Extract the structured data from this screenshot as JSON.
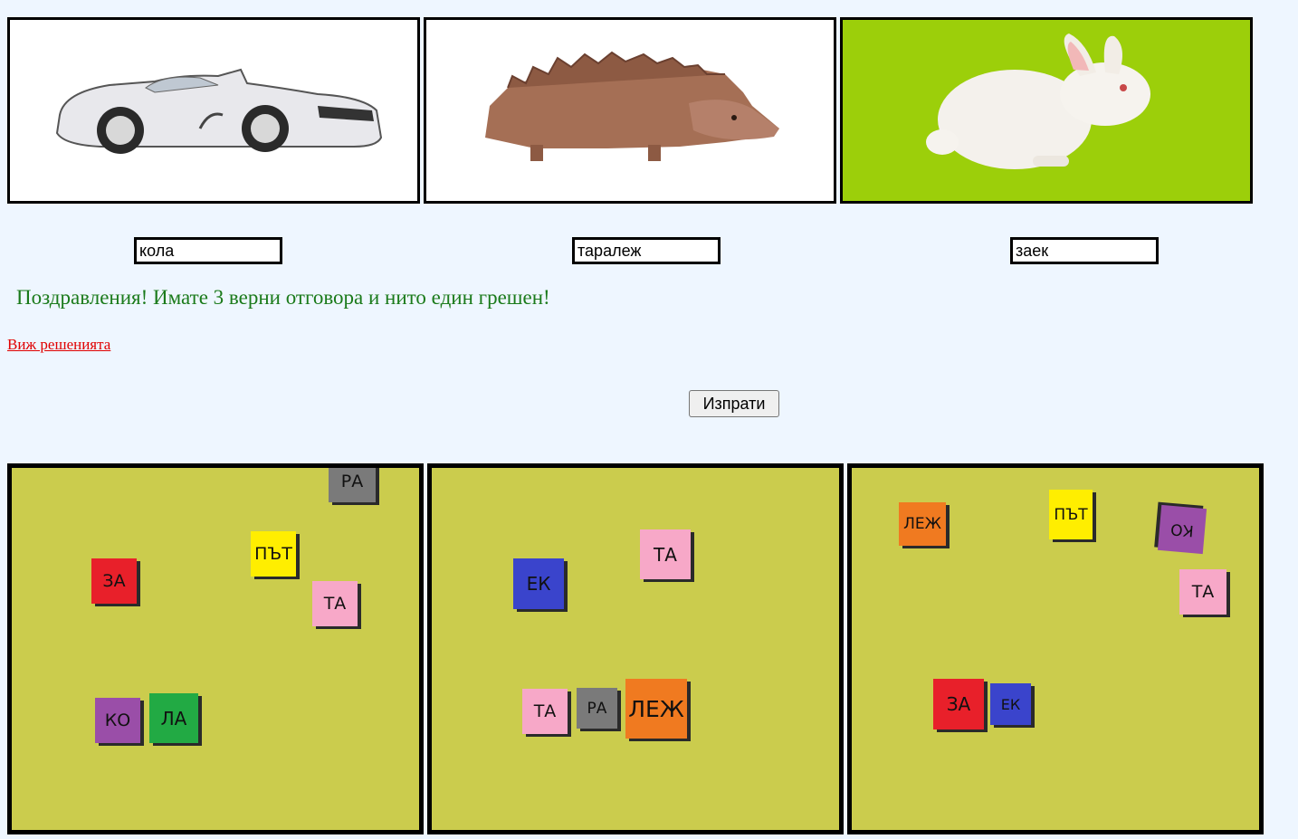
{
  "pictures": [
    {
      "name": "car",
      "background": "#ffffff"
    },
    {
      "name": "hedgehog",
      "background": "#ffffff"
    },
    {
      "name": "rabbit",
      "background": "#9ccf0a"
    }
  ],
  "answers": [
    {
      "value": "кола"
    },
    {
      "value": "таралеж"
    },
    {
      "value": "заек"
    }
  ],
  "result_message": "Поздравления! Имате 3 верни отговора и нито един грешен!",
  "solutions_link": "Виж решенията",
  "submit_label": "Изпрати",
  "boards": [
    {
      "background": "#cbcc4d",
      "cubes": [
        {
          "label": "РА",
          "color": "#7a7a7a"
        },
        {
          "label": "ПЪТ",
          "color": "#ffee00"
        },
        {
          "label": "ЗА",
          "color": "#e8202a"
        },
        {
          "label": "ТА",
          "color": "#f7a8c8"
        },
        {
          "label": "КО",
          "color": "#9a4ea8"
        },
        {
          "label": "ЛА",
          "color": "#22aa44"
        }
      ]
    },
    {
      "background": "#cbcc4d",
      "cubes": [
        {
          "label": "ТА",
          "color": "#f7a8c8"
        },
        {
          "label": "ЕК",
          "color": "#3a44cc"
        },
        {
          "label": "ТА",
          "color": "#f7a8c8"
        },
        {
          "label": "РА",
          "color": "#7a7a7a"
        },
        {
          "label": "ЛЕЖ",
          "color": "#f07a20"
        }
      ]
    },
    {
      "background": "#cbcc4d",
      "cubes": [
        {
          "label": "ЛЕЖ",
          "color": "#f07a20"
        },
        {
          "label": "ПЪТ",
          "color": "#ffee00"
        },
        {
          "label": "КО",
          "color": "#9a4ea8"
        },
        {
          "label": "ТА",
          "color": "#f7a8c8"
        },
        {
          "label": "ЗА",
          "color": "#e8202a"
        },
        {
          "label": "ЕК",
          "color": "#3a44cc"
        }
      ]
    }
  ]
}
